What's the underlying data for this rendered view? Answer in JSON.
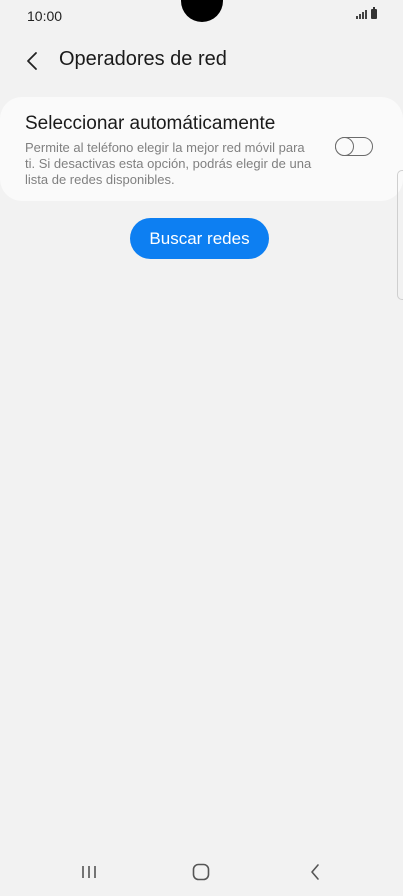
{
  "status_bar": {
    "time": "10:00"
  },
  "header": {
    "title": "Operadores de red"
  },
  "auto_select": {
    "title": "Seleccionar automáticamente",
    "description": "Permite al teléfono elegir la mejor red móvil para ti. Si desactivas esta opción, podrás elegir de una lista de redes disponibles.",
    "toggle_on": false
  },
  "search_button": {
    "label": "Buscar redes",
    "color": "#0d7ff2"
  },
  "icons": {
    "back": "chevron-left-icon",
    "signal": "signal-icon",
    "battery": "battery-icon",
    "recents": "recents-icon",
    "home": "home-icon",
    "nav_back": "nav-back-icon"
  }
}
